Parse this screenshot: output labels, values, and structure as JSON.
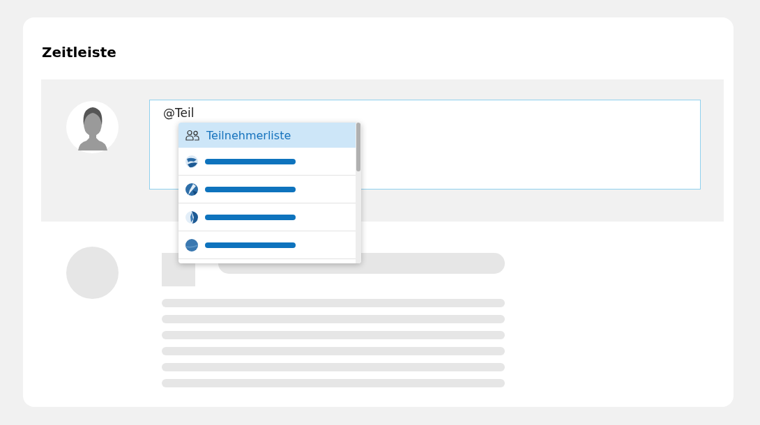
{
  "panel": {
    "title": "Zeitleiste"
  },
  "composer": {
    "value": "@Teil"
  },
  "suggestions": [
    {
      "kind": "group",
      "label": "Teilnehmerliste",
      "selected": true
    },
    {
      "kind": "contact",
      "selected": false
    },
    {
      "kind": "contact",
      "selected": false
    },
    {
      "kind": "contact",
      "selected": false
    },
    {
      "kind": "contact",
      "selected": false
    }
  ]
}
